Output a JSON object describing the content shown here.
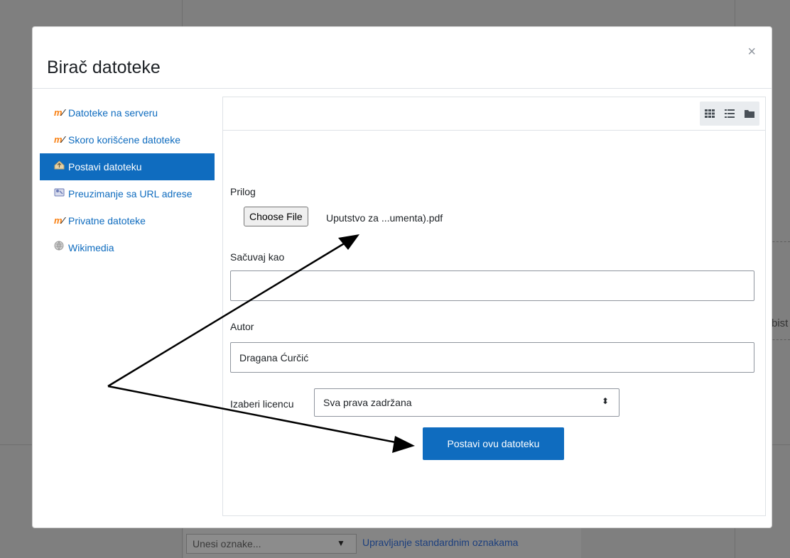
{
  "background": {
    "tag_input_placeholder": "Unesi oznake...",
    "tag_dropdown_icon": "triangle-down-icon",
    "manage_tags_link": "Upravljanje standardnim oznakama",
    "side_text": "bist"
  },
  "dialog": {
    "title": "Birač datoteke",
    "close_label": "×"
  },
  "repositories": [
    {
      "label": "Datoteke na serveru",
      "icon": "moodle-icon"
    },
    {
      "label": "Skoro korišćene datoteke",
      "icon": "moodle-icon"
    },
    {
      "label": "Postavi datoteku",
      "icon": "upload-icon",
      "active": true
    },
    {
      "label": "Preuzimanje sa URL adrese",
      "icon": "url-download-icon"
    },
    {
      "label": "Privatne datoteke",
      "icon": "moodle-icon"
    },
    {
      "label": "Wikimedia",
      "icon": "wikimedia-icon"
    }
  ],
  "toolbar": {
    "views": [
      "icons-view-icon",
      "list-view-icon",
      "tree-view-icon"
    ]
  },
  "form": {
    "attachment_label": "Prilog",
    "choose_file_button": "Choose File",
    "chosen_file": "Uputstvo za ...umenta).pdf",
    "save_as_label": "Sačuvaj kao",
    "save_as_value": "",
    "author_label": "Autor",
    "author_value": "Dragana Ćurčić",
    "license_label": "Izaberi licencu",
    "license_value": "Sva prava zadržana",
    "submit_button": "Postavi ovu datoteku"
  },
  "colors": {
    "accent": "#0f6cbf",
    "moodle_orange": "#f98012"
  }
}
